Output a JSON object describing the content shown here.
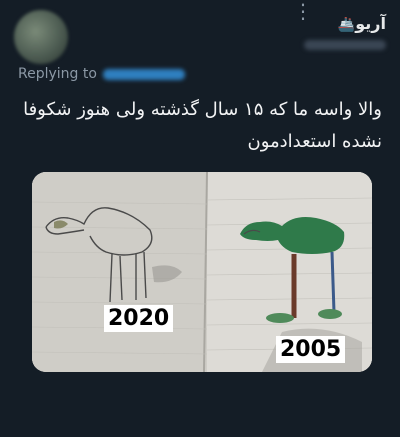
{
  "tweet": {
    "display_name": "آریو",
    "name_emoji": "🚢",
    "more_icon": "more-dots-icon",
    "replying_prefix": "Replying to",
    "text": "والا واسه ما که ۱۵ سال گذشته ولی هنوز شکوفا نشده استعدادمون"
  },
  "media": {
    "left_label": "2020",
    "right_label": "2005"
  }
}
